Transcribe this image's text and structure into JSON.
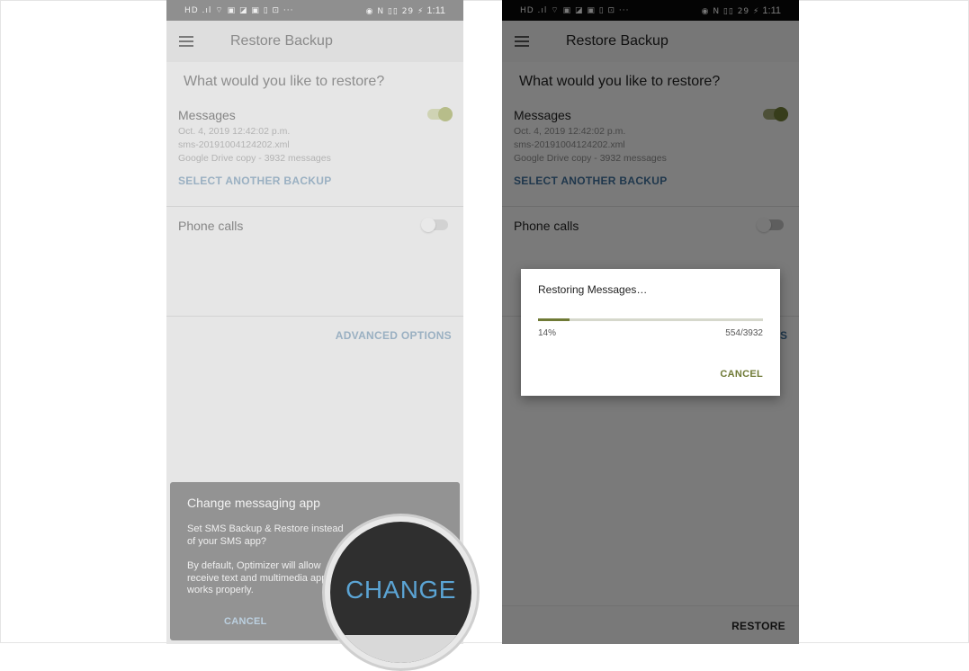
{
  "status_bar": {
    "left_icons": "HD .ıl ⌔ ▣ ◪ ▣ ▯ ⊡ ···",
    "right_icons": "◉ N ▯▯ 29 ⚡",
    "time": "1:11"
  },
  "left_screen": {
    "app_title": "Restore Backup",
    "question": "What would you like to restore?",
    "messages": {
      "title": "Messages",
      "date": "Oct. 4, 2019 12:42:02 p.m.",
      "file": "sms-20191004124202.xml",
      "source": "Google Drive copy - 3932 messages",
      "toggle_on": true
    },
    "select_another_label": "SELECT ANOTHER BACKUP",
    "phone_calls": {
      "title": "Phone calls",
      "toggle_on": false
    },
    "advanced_label": "ADVANCED OPTIONS",
    "sheet": {
      "title": "Change messaging app",
      "text1": "Set SMS Backup & Restore instead of your SMS app?",
      "text2": "By default, Optimizer will allow receive text and multimedia app works properly.",
      "cancel_label": "CANCEL"
    },
    "magnifier": {
      "change_label": "CHANGE"
    }
  },
  "right_screen": {
    "app_title": "Restore Backup",
    "question": "What would you like to restore?",
    "messages": {
      "title": "Messages",
      "date": "Oct. 4, 2019 12:42:02 p.m.",
      "file": "sms-20191004124202.xml",
      "source": "Google Drive copy - 3932 messages",
      "toggle_on": true
    },
    "select_another_label": "SELECT ANOTHER BACKUP",
    "phone_calls": {
      "title": "Phone calls",
      "toggle_on": false
    },
    "advanced_fragment": "S",
    "dialog": {
      "title": "Restoring Messages…",
      "progress": 0.14,
      "percent_label": "14%",
      "count_label": "554/3932",
      "cancel_label": "CANCEL"
    },
    "restore_label": "RESTORE"
  },
  "colors": {
    "accent_olive": "#6f7a36",
    "link_blue": "#3f6f99",
    "change_blue": "#5ba4d4"
  }
}
